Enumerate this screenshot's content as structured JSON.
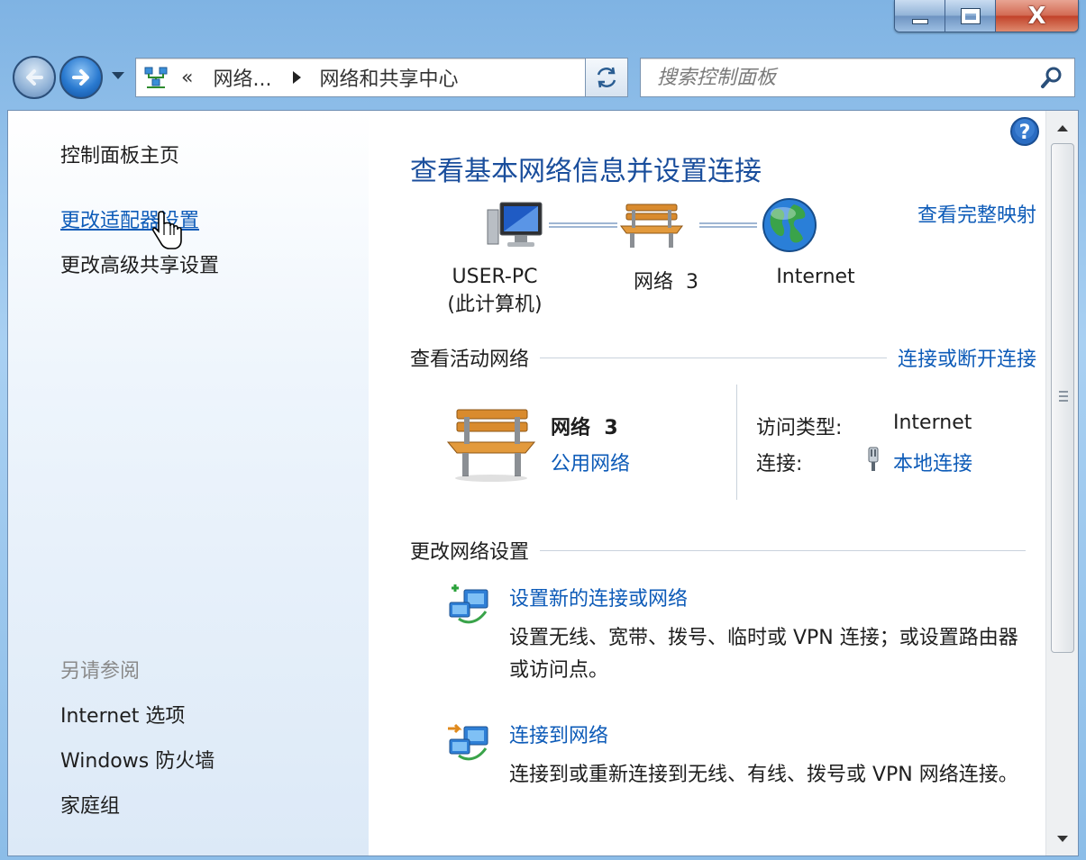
{
  "window": {
    "minimize_label": "",
    "maximize_label": "",
    "close_label": "X"
  },
  "navbar": {
    "breadcrumb_chevron": "«",
    "breadcrumb_parent": "网络...",
    "breadcrumb_current": "网络和共享中心",
    "search_placeholder": "搜索控制面板"
  },
  "sidebar": {
    "home": "控制面板主页",
    "change_adapter": "更改适配器设置",
    "change_sharing": "更改高级共享设置",
    "see_also": "另请参阅",
    "internet_options": "Internet 选项",
    "firewall": "Windows 防火墙",
    "homegroup": "家庭组"
  },
  "main": {
    "title": "查看基本网络信息并设置连接",
    "view_full_map": "查看完整映射",
    "map": {
      "computer_name": "USER-PC",
      "computer_note": "(此计算机)",
      "network_name": "网络  3",
      "internet": "Internet"
    },
    "active_section": {
      "heading": "查看活动网络",
      "link": "连接或断开连接",
      "network_name": "网络  3",
      "network_type": "公用网络",
      "access_type_label": "访问类型:",
      "access_type_value": "Internet",
      "connections_label": "连接:",
      "connections_value": "本地连接"
    },
    "change_section": {
      "heading": "更改网络设置",
      "tasks": [
        {
          "link": "设置新的连接或网络",
          "desc": "设置无线、宽带、拨号、临时或 VPN 连接；或设置路由器或访问点。"
        },
        {
          "link": "连接到网络",
          "desc": "连接到或重新连接到无线、有线、拨号或 VPN 网络连接。"
        }
      ]
    }
  },
  "colors": {
    "link": "#0d5bb8",
    "title": "#1a4e9c"
  }
}
